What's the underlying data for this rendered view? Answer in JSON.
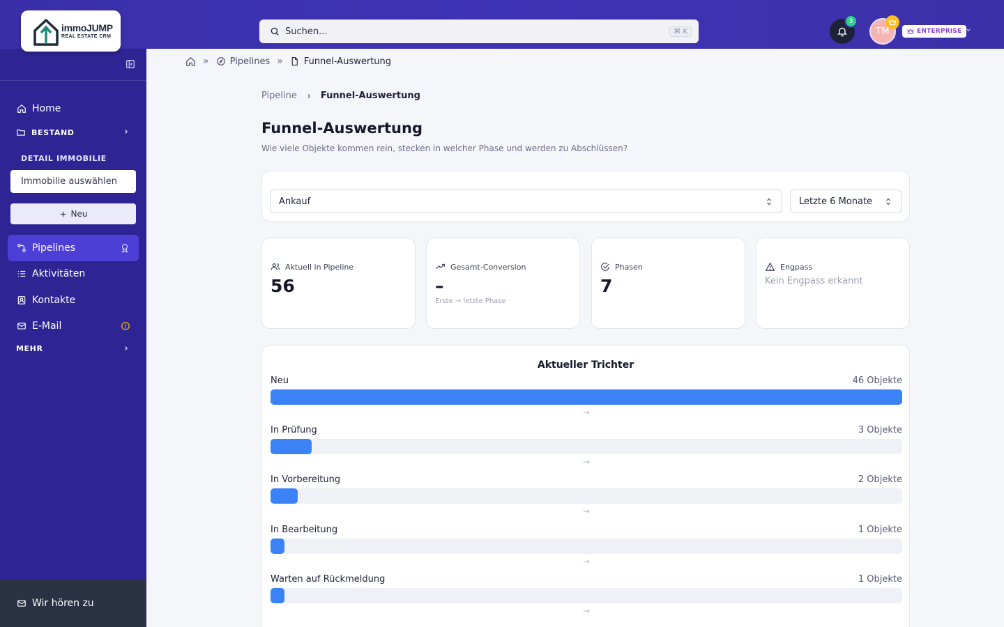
{
  "header": {
    "logo_title": "immoJUMP",
    "logo_subtitle": "REAL ESTATE CRM",
    "search_placeholder": "Suchen...",
    "search_shortcut": "⌘ K",
    "notification_count": "3",
    "avatar_initials": "TM",
    "plan_label": "ENTERPRISE"
  },
  "sidebar": {
    "home_label": "Home",
    "bestand_label": "BESTAND",
    "detail_section_label": "DETAIL IMMOBILIE",
    "property_select_placeholder": "Immobilie auswählen",
    "new_button_label": "Neu",
    "pipelines_label": "Pipelines",
    "activities_label": "Aktivitäten",
    "contacts_label": "Kontakte",
    "email_label": "E-Mail",
    "more_label": "MEHR",
    "feedback_label": "Wir hören zu"
  },
  "breadcrumb": {
    "pipelines": "Pipelines",
    "current": "Funnel-Auswertung"
  },
  "subcrumb": {
    "parent": "Pipeline",
    "current": "Funnel-Auswertung"
  },
  "page": {
    "title": "Funnel-Auswertung",
    "description": "Wie viele Objekte kommen rein, stecken in welcher Phase und werden zu Abschlüssen?"
  },
  "filters": {
    "pipeline_value": "Ankauf",
    "range_value": "Letzte 6 Monate"
  },
  "stats": {
    "in_pipeline_label": "Aktuell in Pipeline",
    "in_pipeline_value": "56",
    "conversion_label": "Gesamt-Conversion",
    "conversion_value": "–",
    "conversion_note": "Erste → letzte Phase",
    "phases_label": "Phasen",
    "phases_value": "7",
    "bottleneck_label": "Engpass",
    "bottleneck_value": "Kein Engpass erkannt"
  },
  "funnel": {
    "title": "Aktueller Trichter",
    "arrow": "→",
    "max": 46,
    "stages": [
      {
        "name": "Neu",
        "count_label": "46 Objekte",
        "count": 46
      },
      {
        "name": "In Prüfung",
        "count_label": "3 Objekte",
        "count": 3
      },
      {
        "name": "In Vorbereitung",
        "count_label": "2 Objekte",
        "count": 2
      },
      {
        "name": "In Bearbeitung",
        "count_label": "1 Objekte",
        "count": 1
      },
      {
        "name": "Warten auf Rückmeldung",
        "count_label": "1 Objekte",
        "count": 1
      }
    ]
  },
  "colors": {
    "brand": "#3a2fa8",
    "sidebar": "#2e2493",
    "active_nav": "#4d3fd6",
    "bar": "#3b82f6",
    "email_warning": "#f5b50f"
  }
}
